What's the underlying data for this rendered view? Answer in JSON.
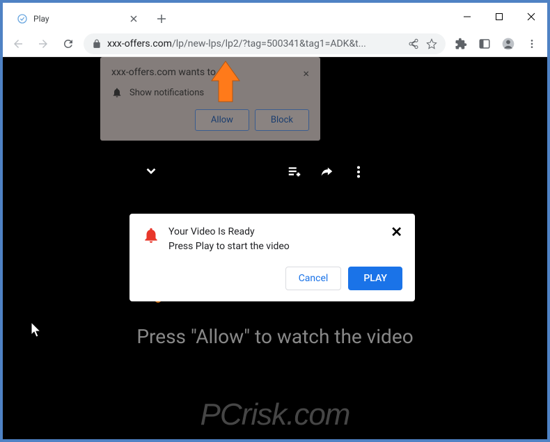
{
  "tab": {
    "title": "Play"
  },
  "address_bar": {
    "domain": "xxx-offers.com",
    "path": "/lp/new-lps/lp2/?tag=500341&tag1=ADK&t..."
  },
  "notification_popup": {
    "title": "xxx-offers.com wants to",
    "permission_label": "Show notifications",
    "allow_label": "Allow",
    "block_label": "Block"
  },
  "ready_dialog": {
    "title": "Your Video Is Ready",
    "subtitle": "Press Play to start the video",
    "cancel_label": "Cancel",
    "play_label": "PLAY"
  },
  "big_text": "Press \"Allow\" to watch the video",
  "watermark": "PCrisk.com"
}
